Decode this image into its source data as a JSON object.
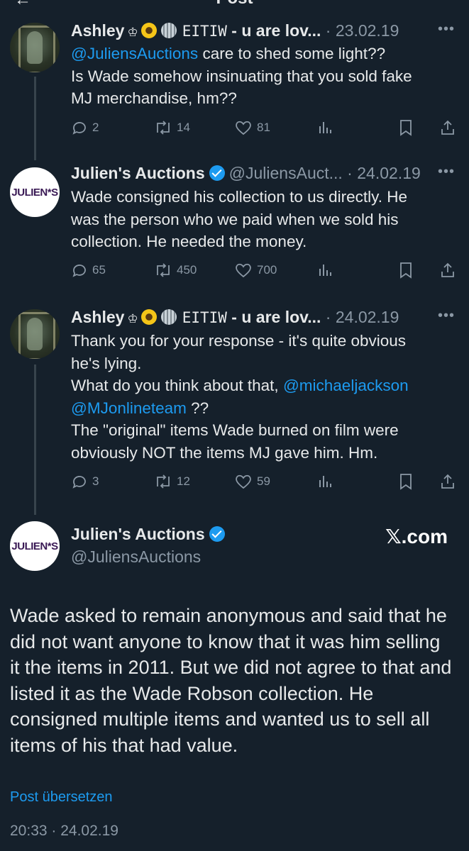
{
  "header": {
    "title": "Post"
  },
  "tweets": [
    {
      "name": "Ashley",
      "crown": "♔",
      "extra": "EITIW",
      "tail": " - u are lov...",
      "separator": " · ",
      "date": "23.02.19",
      "lines": [
        {
          "mention": "@JuliensAuctions",
          "text": " care to shed some light??"
        },
        {
          "text": "Is Wade somehow insinuating that you sold fake"
        },
        {
          "text": "MJ merchandise, hm??"
        }
      ],
      "replies": "2",
      "reposts": "14",
      "likes": "81"
    },
    {
      "name": "Julien's Auctions",
      "handle": "@JuliensAuct...",
      "separator": " · ",
      "date": "24.02.19",
      "logo_text": "JULIEN*S",
      "lines": [
        {
          "text": "Wade consigned his collection to us directly. He"
        },
        {
          "text": "was the person who we paid when we sold his"
        },
        {
          "text": "collection. He needed the money."
        }
      ],
      "replies": "65",
      "reposts": "450",
      "likes": "700"
    },
    {
      "name": "Ashley",
      "crown": "♔",
      "extra": "EITIW",
      "tail": " - u are lov...",
      "separator": " · ",
      "date": "24.02.19",
      "lines": [
        {
          "text": "Thank you for your response - it's quite obvious"
        },
        {
          "text": "he's lying."
        },
        {
          "text": "What do you think about that, ",
          "mention": "@michaeljackson"
        },
        {
          "mention": "@MJonlineteam",
          "text": " ??"
        },
        {
          "text": "The \"original\" items Wade burned on film were"
        },
        {
          "text": "obviously NOT the items MJ gave him. Hm."
        }
      ],
      "replies": "3",
      "reposts": "12",
      "likes": "59"
    }
  ],
  "main": {
    "name": "Julien's Auctions",
    "handle": "@JuliensAuctions",
    "logo_text": "JULIEN*S",
    "watermark": "𝕏.com",
    "text": "Wade asked to remain anonymous and said that he did not want anyone to know that it was him selling it the items in 2011. But we did not agree to that and listed it as the Wade Robson collection. He consigned multiple items and wanted us to sell all items of his that had value.",
    "translate": "Post übersetzen",
    "timestamp": "20:33 · 24.02.19"
  },
  "icons": [
    "back-arrow-icon",
    "verified-badge-icon",
    "reply-icon",
    "repost-icon",
    "like-icon",
    "views-icon",
    "bookmark-icon",
    "share-icon",
    "more-icon"
  ]
}
